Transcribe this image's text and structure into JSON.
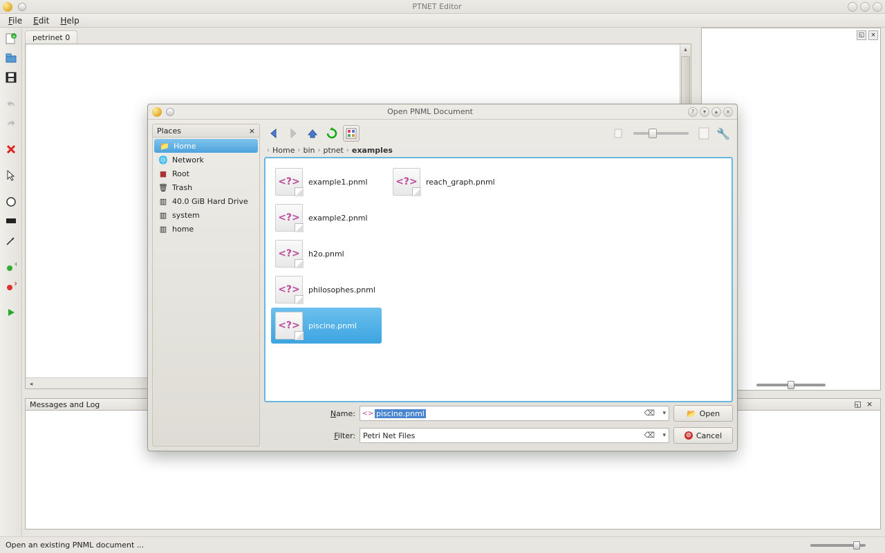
{
  "window": {
    "title": "PTNET Editor"
  },
  "menu": {
    "file": "File",
    "edit": "Edit",
    "help": "Help"
  },
  "tab": {
    "name": "petrinet 0"
  },
  "messages": {
    "title": "Messages and Log"
  },
  "status": {
    "text": "Open an existing PNML document ..."
  },
  "dialog": {
    "title": "Open PNML Document",
    "places_header": "Places",
    "places": {
      "home": "Home",
      "network": "Network",
      "root": "Root",
      "trash": "Trash",
      "drive": "40.0 GiB Hard Drive",
      "system": "system",
      "home2": "home"
    },
    "breadcrumb": {
      "p1": "Home",
      "p2": "bin",
      "p3": "ptnet",
      "p4": "examples"
    },
    "files": {
      "f1": "example1.pnml",
      "f2": "example2.pnml",
      "f3": "h2o.pnml",
      "f4": "philosophes.pnml",
      "f5": "piscine.pnml",
      "f6": "reach_graph.pnml"
    },
    "name_label": "Name:",
    "name_value": "piscine.pnml",
    "filter_label": "Filter:",
    "filter_value": "Petri Net Files",
    "open": "Open",
    "cancel": "Cancel"
  }
}
